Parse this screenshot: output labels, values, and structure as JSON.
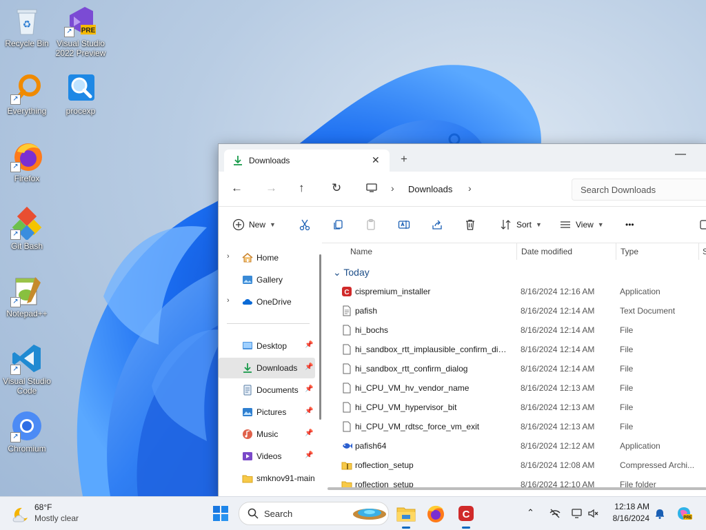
{
  "desktop": {
    "icons": [
      {
        "label": "Recycle Bin"
      },
      {
        "label": "Visual Studio 2022 Preview",
        "badge": "PRE"
      },
      {
        "label": "Everything"
      },
      {
        "label": "procexp"
      },
      {
        "label": "Firefox"
      },
      {
        "label": "Git Bash"
      },
      {
        "label": "Notepad++"
      },
      {
        "label": "Visual Studio Code"
      },
      {
        "label": "Chromium"
      }
    ]
  },
  "explorer": {
    "tab_title": "Downloads",
    "tab_close": "✕",
    "new_tab": "+",
    "minimize": "—",
    "nav": {
      "back": "←",
      "forward": "→",
      "up": "↑",
      "refresh": "↻"
    },
    "address": {
      "sep": "›",
      "crumb": "Downloads"
    },
    "search_placeholder": "Search Downloads",
    "toolbar": {
      "new": "New",
      "sort": "Sort",
      "view": "View",
      "more": "•••"
    },
    "navpane": [
      {
        "label": "Home",
        "expand": "›"
      },
      {
        "label": "Gallery"
      },
      {
        "label": "OneDrive",
        "expand": "›"
      },
      {
        "label": "Desktop",
        "pinned": true
      },
      {
        "label": "Downloads",
        "pinned": true,
        "selected": true
      },
      {
        "label": "Documents",
        "pinned": true
      },
      {
        "label": "Pictures",
        "pinned": true
      },
      {
        "label": "Music",
        "pinned": true
      },
      {
        "label": "Videos",
        "pinned": true
      },
      {
        "label": "smknov91-main"
      }
    ],
    "columns": {
      "name": "Name",
      "date": "Date modified",
      "type": "Type",
      "size": "S"
    },
    "group": "Today",
    "group_chevron": "⌄",
    "files": [
      {
        "name": "cispremium_installer",
        "date": "8/16/2024 12:16 AM",
        "type": "Application",
        "icon": "comodo-icon"
      },
      {
        "name": "pafish",
        "date": "8/16/2024 12:14 AM",
        "type": "Text Document",
        "icon": "text-file-icon"
      },
      {
        "name": "hi_bochs",
        "date": "8/16/2024 12:14 AM",
        "type": "File",
        "icon": "file-icon"
      },
      {
        "name": "hi_sandbox_rtt_implausible_confirm_dial...",
        "date": "8/16/2024 12:14 AM",
        "type": "File",
        "icon": "file-icon"
      },
      {
        "name": "hi_sandbox_rtt_confirm_dialog",
        "date": "8/16/2024 12:14 AM",
        "type": "File",
        "icon": "file-icon"
      },
      {
        "name": "hi_CPU_VM_hv_vendor_name",
        "date": "8/16/2024 12:13 AM",
        "type": "File",
        "icon": "file-icon"
      },
      {
        "name": "hi_CPU_VM_hypervisor_bit",
        "date": "8/16/2024 12:13 AM",
        "type": "File",
        "icon": "file-icon"
      },
      {
        "name": "hi_CPU_VM_rdtsc_force_vm_exit",
        "date": "8/16/2024 12:13 AM",
        "type": "File",
        "icon": "file-icon"
      },
      {
        "name": "pafish64",
        "date": "8/16/2024 12:12 AM",
        "type": "Application",
        "icon": "fish-app-icon"
      },
      {
        "name": "roflection_setup",
        "date": "8/16/2024 12:08 AM",
        "type": "Compressed Archi...",
        "icon": "zip-folder-icon"
      },
      {
        "name": "roflection_setup",
        "date": "8/16/2024 12:10 AM",
        "type": "File folder",
        "icon": "folder-icon"
      }
    ]
  },
  "taskbar": {
    "weather": {
      "temp": "68°F",
      "desc": "Mostly clear"
    },
    "search_label": "Search",
    "time": "12:18 AM",
    "date": "8/16/2024",
    "accent": "#0067c0"
  }
}
